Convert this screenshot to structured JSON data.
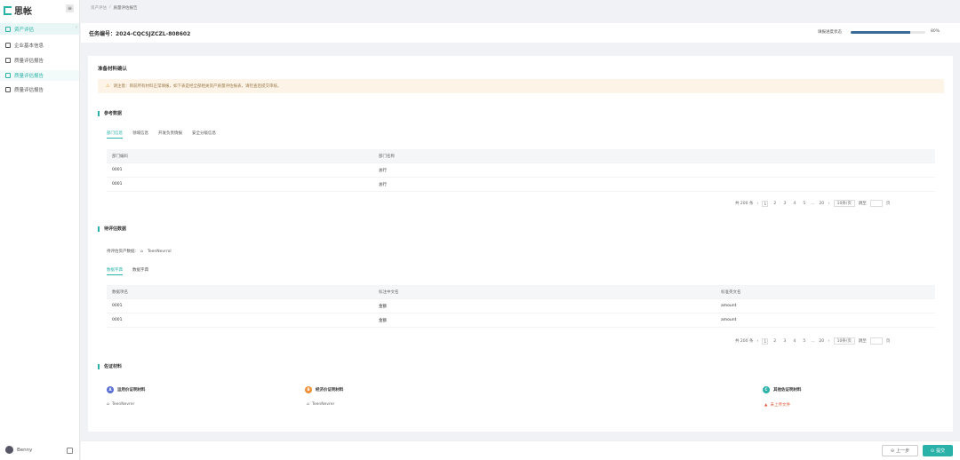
{
  "app": {
    "logo_text": "思帐"
  },
  "sidebar": {
    "group_label": "资产评估",
    "items": [
      {
        "label": "企业基本信息"
      },
      {
        "label": "质量评估报告"
      },
      {
        "label": "质量评估报告"
      },
      {
        "label": "质量评估报告"
      }
    ],
    "user_name": "Benny"
  },
  "breadcrumb": {
    "parent": "资产评估",
    "current": "质量评估报告"
  },
  "header": {
    "app_no_label": "任务编号：",
    "app_no": "2024-CQCSJZCZL-808602",
    "progress_label": "填报进度状态",
    "progress_value": 0.8,
    "progress_text": "80%"
  },
  "card": {
    "title": "准备材料确认",
    "alert_text": "请注意：目前所有材料正常填报，如下表是经全部相关资产质量评估报表，请检查后提交审核。",
    "ref_section": "参考数据",
    "ref_tabs": [
      "部门信息",
      "领域信息",
      "开发负责情报",
      "安全分级信息"
    ],
    "ref_table": {
      "headers": [
        "部门编码",
        "部门名称"
      ],
      "rows": [
        [
          "0001",
          "总行"
        ],
        [
          "0001",
          "总行"
        ]
      ]
    },
    "pager": {
      "total": "共 200 条",
      "pages": [
        "1",
        "2",
        "3",
        "4",
        "5"
      ],
      "more": "…",
      "last": "20",
      "size": "10条/页",
      "jump": "跳至",
      "page_unit": "页"
    },
    "eval_section": "待评估数据",
    "eval_file_label": "待评估资产数据:",
    "eval_file_name": "TeenNevrrol",
    "eval_tabs": [
      "数据字典",
      "数据字典"
    ],
    "eval_table": {
      "headers": [
        "数据项名",
        "标注中文名",
        "标准英文名"
      ],
      "rows": [
        [
          "0001",
          "金额",
          "amount"
        ],
        [
          "0001",
          "金额",
          "amount"
        ]
      ]
    },
    "mat_section": "佐证材料",
    "materials": [
      {
        "icon": "A",
        "color": "#5b6fd6",
        "title": "运用价证明材料",
        "file": "TeenNevrer",
        "warn": false
      },
      {
        "icon": "B",
        "color": "#f0903a",
        "title": "经济价证明材料",
        "file": "TeenNevrer",
        "warn": false
      },
      {
        "icon": "C",
        "color": "#2ab2a8",
        "title": "其他佐证明材料",
        "file": "未上传文件",
        "warn": true
      }
    ]
  },
  "footer": {
    "prev_label": "上一步",
    "submit_label": "提交"
  }
}
